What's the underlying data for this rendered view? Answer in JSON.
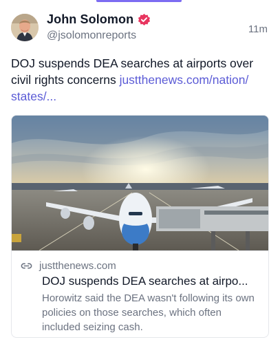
{
  "author": {
    "display_name": "John Solomon",
    "handle": "@jsolomonreports",
    "verified_icon": "verified-badge-icon",
    "avatar_icon": "avatar"
  },
  "post": {
    "timestamp": "11m",
    "text_lines": [
      "DOJ suspends DEA searches at airports over",
      "civil rights concerns "
    ],
    "link_text_part1": "justthenews.com/nation/",
    "link_text_part2": "states/..."
  },
  "link_card": {
    "image_alt": "Airplane parked at airport gate under sunset sky",
    "domain": "justthenews.com",
    "title": "DOJ suspends DEA searches at airpo...",
    "description": "Horowitz said the DEA wasn't following its own policies on those searches, which often included seizing cash.",
    "link_icon": "link-icon"
  },
  "colors": {
    "accent": "#7c6cf2",
    "link": "#5b5bd6",
    "verified": "#e8355f",
    "muted_text": "#6b7280"
  }
}
